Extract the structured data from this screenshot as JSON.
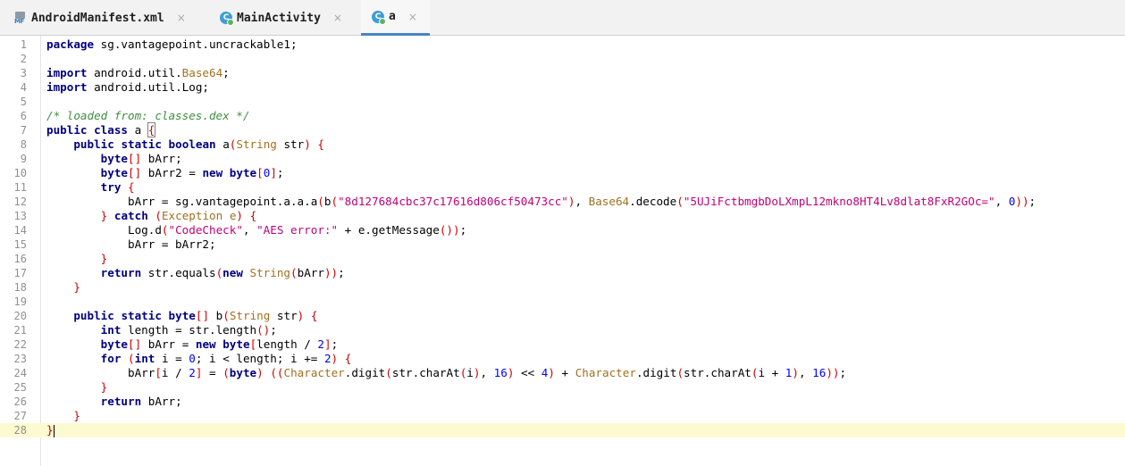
{
  "tabs": [
    {
      "label": "AndroidManifest.xml",
      "icon": "manifest-file-icon",
      "active": false
    },
    {
      "label": "MainActivity",
      "icon": "class-icon",
      "active": false
    },
    {
      "label": "a",
      "icon": "class-icon",
      "active": true
    }
  ],
  "tab_close_glyph": "×",
  "class_icon_letter": "C",
  "manifest_icon_text": "MF",
  "editor": {
    "current_line": 28,
    "line_numbers": [
      "1",
      "2",
      "3",
      "4",
      "5",
      "6",
      "7",
      "8",
      "9",
      "10",
      "11",
      "12",
      "13",
      "14",
      "15",
      "16",
      "17",
      "18",
      "19",
      "20",
      "21",
      "22",
      "23",
      "24",
      "25",
      "26",
      "27",
      "28"
    ],
    "lines": [
      "package sg.vantagepoint.uncrackable1;",
      "",
      "import android.util.Base64;",
      "import android.util.Log;",
      "",
      "/* loaded from: classes.dex */",
      "public class a {",
      "    public static boolean a(String str) {",
      "        byte[] bArr;",
      "        byte[] bArr2 = new byte[0];",
      "        try {",
      "            bArr = sg.vantagepoint.a.a.a(b(\"8d127684cbc37c17616d806cf50473cc\"), Base64.decode(\"5UJiFctbmgbDoLXmpL12mkno8HT4Lv8dlat8FxR2GOc=\", 0));",
      "        } catch (Exception e) {",
      "            Log.d(\"CodeCheck\", \"AES error:\" + e.getMessage());",
      "            bArr = bArr2;",
      "        }",
      "        return str.equals(new String(bArr));",
      "    }",
      "",
      "    public static byte[] b(String str) {",
      "        int length = str.length();",
      "        byte[] bArr = new byte[length / 2];",
      "        for (int i = 0; i < length; i += 2) {",
      "            bArr[i / 2] = (byte) ((Character.digit(str.charAt(i), 16) << 4) + Character.digit(str.charAt(i + 1), 16));",
      "        }",
      "        return bArr;",
      "    }",
      "}"
    ]
  }
}
